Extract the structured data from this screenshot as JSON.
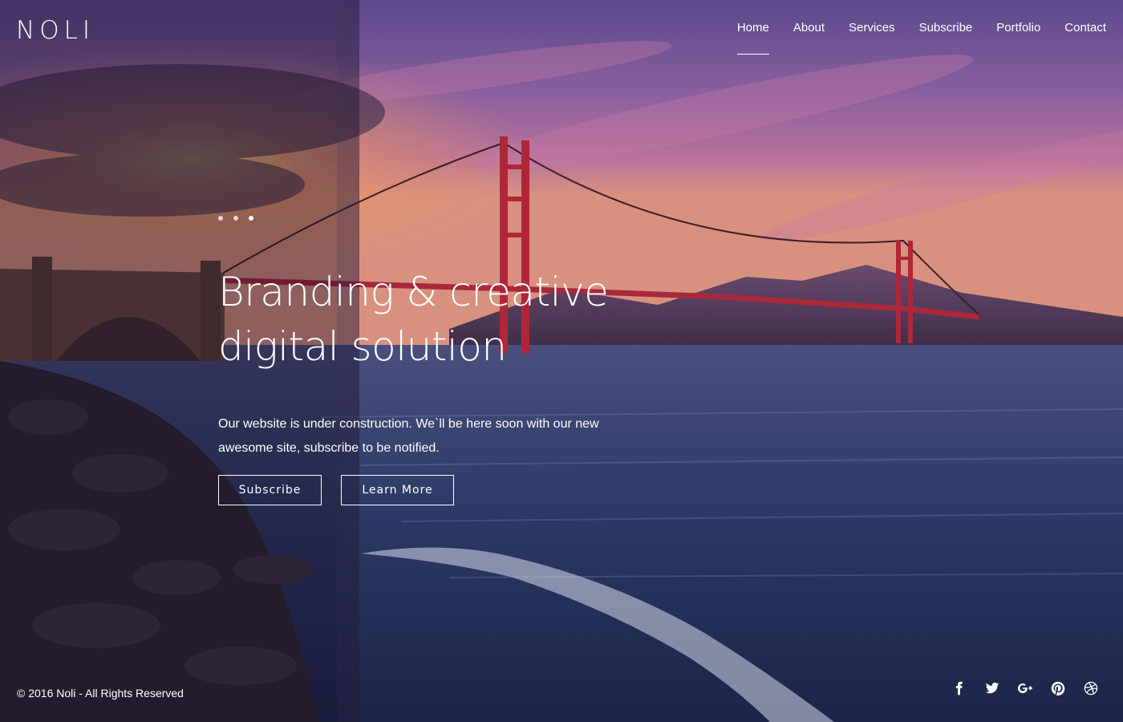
{
  "brand": {
    "logo": "NOLI"
  },
  "nav": {
    "items": [
      {
        "label": "Home",
        "active": true
      },
      {
        "label": "About"
      },
      {
        "label": "Services"
      },
      {
        "label": "Subscribe"
      },
      {
        "label": "Portfolio"
      },
      {
        "label": "Contact"
      }
    ]
  },
  "slider": {
    "dots": 3,
    "active_dot": 3
  },
  "hero": {
    "headline_line1": "Branding & creative",
    "headline_line2": "digital solution",
    "lead": "Our website is under construction. We`ll be here soon with our new awesome site, subscribe to be notified.",
    "subscribe_label": "Subscribe",
    "learn_more_label": "Learn More"
  },
  "footer": {
    "copyright": "© 2016 Noli - All Rights Reserved",
    "social_icons": [
      "facebook-icon",
      "twitter-icon",
      "google-plus-icon",
      "pinterest-icon",
      "dribbble-icon"
    ]
  }
}
